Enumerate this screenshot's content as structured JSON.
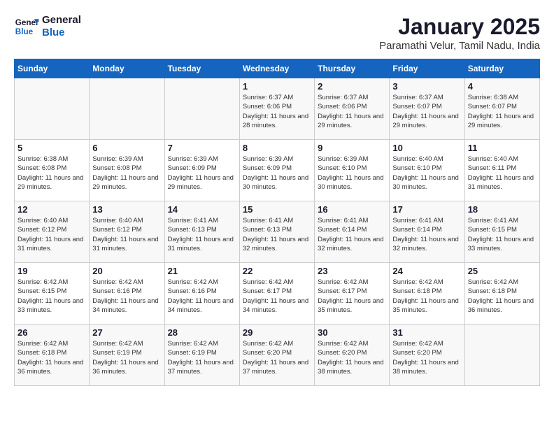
{
  "header": {
    "logo_general": "General",
    "logo_blue": "Blue",
    "title": "January 2025",
    "subtitle": "Paramathi Velur, Tamil Nadu, India"
  },
  "days_of_week": [
    "Sunday",
    "Monday",
    "Tuesday",
    "Wednesday",
    "Thursday",
    "Friday",
    "Saturday"
  ],
  "weeks": [
    [
      {
        "num": "",
        "text": ""
      },
      {
        "num": "",
        "text": ""
      },
      {
        "num": "",
        "text": ""
      },
      {
        "num": "1",
        "text": "Sunrise: 6:37 AM\nSunset: 6:06 PM\nDaylight: 11 hours and 28 minutes."
      },
      {
        "num": "2",
        "text": "Sunrise: 6:37 AM\nSunset: 6:06 PM\nDaylight: 11 hours and 29 minutes."
      },
      {
        "num": "3",
        "text": "Sunrise: 6:37 AM\nSunset: 6:07 PM\nDaylight: 11 hours and 29 minutes."
      },
      {
        "num": "4",
        "text": "Sunrise: 6:38 AM\nSunset: 6:07 PM\nDaylight: 11 hours and 29 minutes."
      }
    ],
    [
      {
        "num": "5",
        "text": "Sunrise: 6:38 AM\nSunset: 6:08 PM\nDaylight: 11 hours and 29 minutes."
      },
      {
        "num": "6",
        "text": "Sunrise: 6:39 AM\nSunset: 6:08 PM\nDaylight: 11 hours and 29 minutes."
      },
      {
        "num": "7",
        "text": "Sunrise: 6:39 AM\nSunset: 6:09 PM\nDaylight: 11 hours and 29 minutes."
      },
      {
        "num": "8",
        "text": "Sunrise: 6:39 AM\nSunset: 6:09 PM\nDaylight: 11 hours and 30 minutes."
      },
      {
        "num": "9",
        "text": "Sunrise: 6:39 AM\nSunset: 6:10 PM\nDaylight: 11 hours and 30 minutes."
      },
      {
        "num": "10",
        "text": "Sunrise: 6:40 AM\nSunset: 6:10 PM\nDaylight: 11 hours and 30 minutes."
      },
      {
        "num": "11",
        "text": "Sunrise: 6:40 AM\nSunset: 6:11 PM\nDaylight: 11 hours and 31 minutes."
      }
    ],
    [
      {
        "num": "12",
        "text": "Sunrise: 6:40 AM\nSunset: 6:12 PM\nDaylight: 11 hours and 31 minutes."
      },
      {
        "num": "13",
        "text": "Sunrise: 6:40 AM\nSunset: 6:12 PM\nDaylight: 11 hours and 31 minutes."
      },
      {
        "num": "14",
        "text": "Sunrise: 6:41 AM\nSunset: 6:13 PM\nDaylight: 11 hours and 31 minutes."
      },
      {
        "num": "15",
        "text": "Sunrise: 6:41 AM\nSunset: 6:13 PM\nDaylight: 11 hours and 32 minutes."
      },
      {
        "num": "16",
        "text": "Sunrise: 6:41 AM\nSunset: 6:14 PM\nDaylight: 11 hours and 32 minutes."
      },
      {
        "num": "17",
        "text": "Sunrise: 6:41 AM\nSunset: 6:14 PM\nDaylight: 11 hours and 32 minutes."
      },
      {
        "num": "18",
        "text": "Sunrise: 6:41 AM\nSunset: 6:15 PM\nDaylight: 11 hours and 33 minutes."
      }
    ],
    [
      {
        "num": "19",
        "text": "Sunrise: 6:42 AM\nSunset: 6:15 PM\nDaylight: 11 hours and 33 minutes."
      },
      {
        "num": "20",
        "text": "Sunrise: 6:42 AM\nSunset: 6:16 PM\nDaylight: 11 hours and 34 minutes."
      },
      {
        "num": "21",
        "text": "Sunrise: 6:42 AM\nSunset: 6:16 PM\nDaylight: 11 hours and 34 minutes."
      },
      {
        "num": "22",
        "text": "Sunrise: 6:42 AM\nSunset: 6:17 PM\nDaylight: 11 hours and 34 minutes."
      },
      {
        "num": "23",
        "text": "Sunrise: 6:42 AM\nSunset: 6:17 PM\nDaylight: 11 hours and 35 minutes."
      },
      {
        "num": "24",
        "text": "Sunrise: 6:42 AM\nSunset: 6:18 PM\nDaylight: 11 hours and 35 minutes."
      },
      {
        "num": "25",
        "text": "Sunrise: 6:42 AM\nSunset: 6:18 PM\nDaylight: 11 hours and 36 minutes."
      }
    ],
    [
      {
        "num": "26",
        "text": "Sunrise: 6:42 AM\nSunset: 6:18 PM\nDaylight: 11 hours and 36 minutes."
      },
      {
        "num": "27",
        "text": "Sunrise: 6:42 AM\nSunset: 6:19 PM\nDaylight: 11 hours and 36 minutes."
      },
      {
        "num": "28",
        "text": "Sunrise: 6:42 AM\nSunset: 6:19 PM\nDaylight: 11 hours and 37 minutes."
      },
      {
        "num": "29",
        "text": "Sunrise: 6:42 AM\nSunset: 6:20 PM\nDaylight: 11 hours and 37 minutes."
      },
      {
        "num": "30",
        "text": "Sunrise: 6:42 AM\nSunset: 6:20 PM\nDaylight: 11 hours and 38 minutes."
      },
      {
        "num": "31",
        "text": "Sunrise: 6:42 AM\nSunset: 6:20 PM\nDaylight: 11 hours and 38 minutes."
      },
      {
        "num": "",
        "text": ""
      }
    ]
  ]
}
